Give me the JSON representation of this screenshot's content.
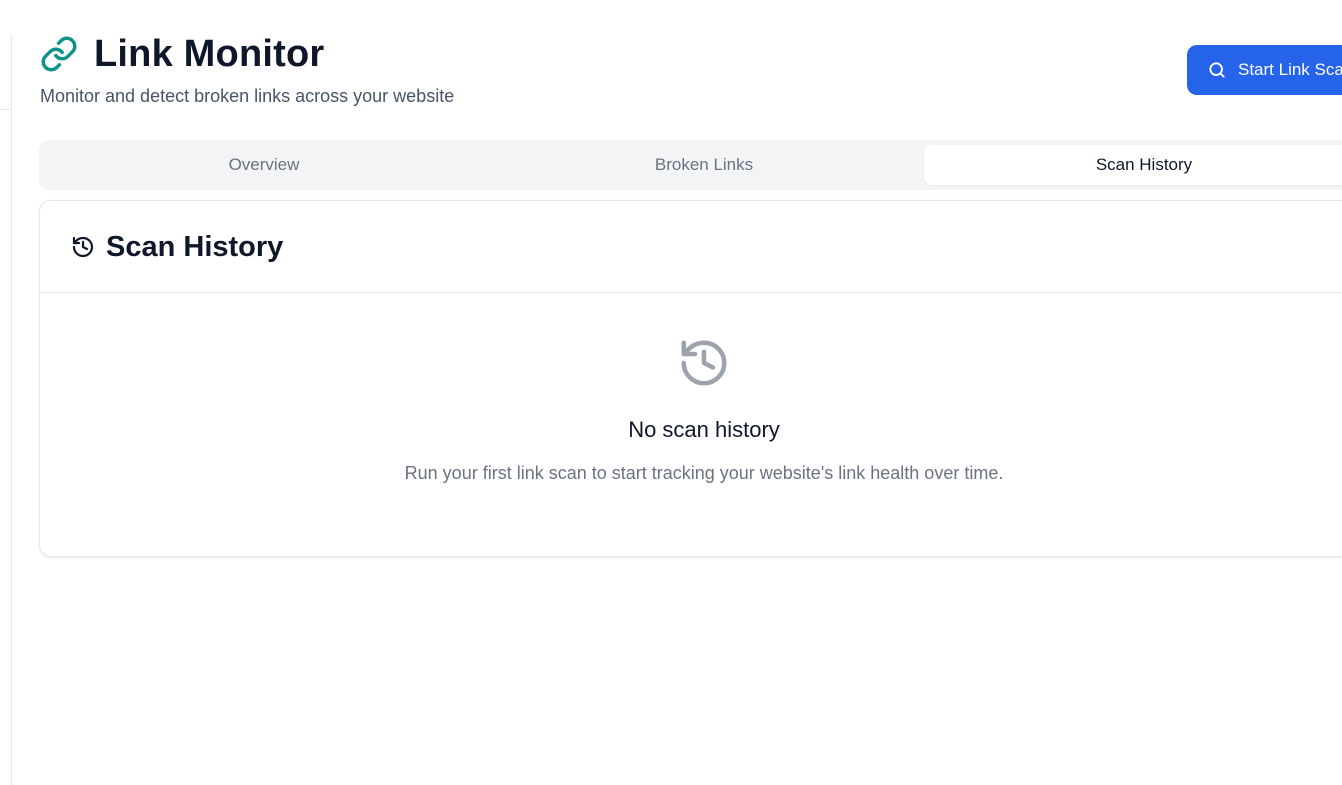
{
  "header": {
    "title": "Link Monitor",
    "subtitle": "Monitor and detect broken links across your website",
    "logo_icon": "link-icon",
    "accent_color": "#0d9488"
  },
  "actions": {
    "scan_button_label": "Start Link Scan",
    "scan_button_icon": "search-icon",
    "scan_button_color": "#2563eb"
  },
  "tabs": [
    {
      "label": "Overview",
      "active": false
    },
    {
      "label": "Broken Links",
      "active": false
    },
    {
      "label": "Scan History",
      "active": true
    }
  ],
  "card": {
    "title": "Scan History",
    "title_icon": "history-icon",
    "empty_state": {
      "icon": "history-icon",
      "title": "No scan history",
      "description": "Run your first link scan to start tracking your website's link health over time."
    }
  }
}
